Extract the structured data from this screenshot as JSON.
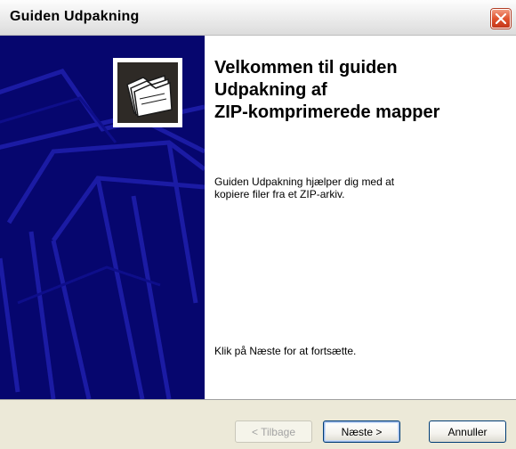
{
  "window": {
    "title": "Guiden Udpakning",
    "close_icon": "close-icon"
  },
  "sidebar": {
    "icon": "folder-stack-icon",
    "background_color": "#06066e"
  },
  "content": {
    "heading_lines": [
      "Velkommen til guiden",
      "Udpakning af",
      "ZIP-komprimerede mapper"
    ],
    "description_lines": [
      "Guiden Udpakning hjælper dig med at",
      "kopiere filer fra et ZIP-arkiv."
    ],
    "continue_text": "Klik på Næste for at fortsætte."
  },
  "buttons": {
    "back": "< Tilbage",
    "next": "Næste >",
    "cancel": "Annuller"
  }
}
